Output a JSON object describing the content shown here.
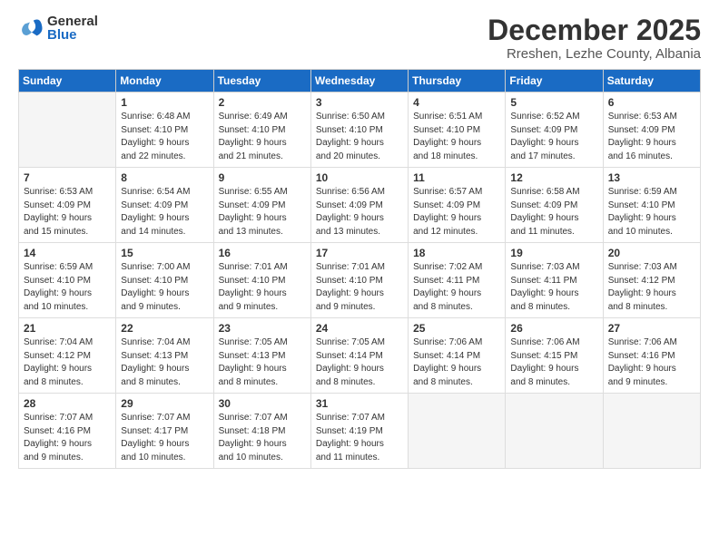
{
  "logo": {
    "general": "General",
    "blue": "Blue"
  },
  "header": {
    "month": "December 2025",
    "location": "Rreshen, Lezhe County, Albania"
  },
  "weekdays": [
    "Sunday",
    "Monday",
    "Tuesday",
    "Wednesday",
    "Thursday",
    "Friday",
    "Saturday"
  ],
  "weeks": [
    [
      {
        "day": "",
        "info": ""
      },
      {
        "day": "1",
        "info": "Sunrise: 6:48 AM\nSunset: 4:10 PM\nDaylight: 9 hours\nand 22 minutes."
      },
      {
        "day": "2",
        "info": "Sunrise: 6:49 AM\nSunset: 4:10 PM\nDaylight: 9 hours\nand 21 minutes."
      },
      {
        "day": "3",
        "info": "Sunrise: 6:50 AM\nSunset: 4:10 PM\nDaylight: 9 hours\nand 20 minutes."
      },
      {
        "day": "4",
        "info": "Sunrise: 6:51 AM\nSunset: 4:10 PM\nDaylight: 9 hours\nand 18 minutes."
      },
      {
        "day": "5",
        "info": "Sunrise: 6:52 AM\nSunset: 4:09 PM\nDaylight: 9 hours\nand 17 minutes."
      },
      {
        "day": "6",
        "info": "Sunrise: 6:53 AM\nSunset: 4:09 PM\nDaylight: 9 hours\nand 16 minutes."
      }
    ],
    [
      {
        "day": "7",
        "info": "Sunrise: 6:53 AM\nSunset: 4:09 PM\nDaylight: 9 hours\nand 15 minutes."
      },
      {
        "day": "8",
        "info": "Sunrise: 6:54 AM\nSunset: 4:09 PM\nDaylight: 9 hours\nand 14 minutes."
      },
      {
        "day": "9",
        "info": "Sunrise: 6:55 AM\nSunset: 4:09 PM\nDaylight: 9 hours\nand 13 minutes."
      },
      {
        "day": "10",
        "info": "Sunrise: 6:56 AM\nSunset: 4:09 PM\nDaylight: 9 hours\nand 13 minutes."
      },
      {
        "day": "11",
        "info": "Sunrise: 6:57 AM\nSunset: 4:09 PM\nDaylight: 9 hours\nand 12 minutes."
      },
      {
        "day": "12",
        "info": "Sunrise: 6:58 AM\nSunset: 4:09 PM\nDaylight: 9 hours\nand 11 minutes."
      },
      {
        "day": "13",
        "info": "Sunrise: 6:59 AM\nSunset: 4:10 PM\nDaylight: 9 hours\nand 10 minutes."
      }
    ],
    [
      {
        "day": "14",
        "info": "Sunrise: 6:59 AM\nSunset: 4:10 PM\nDaylight: 9 hours\nand 10 minutes."
      },
      {
        "day": "15",
        "info": "Sunrise: 7:00 AM\nSunset: 4:10 PM\nDaylight: 9 hours\nand 9 minutes."
      },
      {
        "day": "16",
        "info": "Sunrise: 7:01 AM\nSunset: 4:10 PM\nDaylight: 9 hours\nand 9 minutes."
      },
      {
        "day": "17",
        "info": "Sunrise: 7:01 AM\nSunset: 4:10 PM\nDaylight: 9 hours\nand 9 minutes."
      },
      {
        "day": "18",
        "info": "Sunrise: 7:02 AM\nSunset: 4:11 PM\nDaylight: 9 hours\nand 8 minutes."
      },
      {
        "day": "19",
        "info": "Sunrise: 7:03 AM\nSunset: 4:11 PM\nDaylight: 9 hours\nand 8 minutes."
      },
      {
        "day": "20",
        "info": "Sunrise: 7:03 AM\nSunset: 4:12 PM\nDaylight: 9 hours\nand 8 minutes."
      }
    ],
    [
      {
        "day": "21",
        "info": "Sunrise: 7:04 AM\nSunset: 4:12 PM\nDaylight: 9 hours\nand 8 minutes."
      },
      {
        "day": "22",
        "info": "Sunrise: 7:04 AM\nSunset: 4:13 PM\nDaylight: 9 hours\nand 8 minutes."
      },
      {
        "day": "23",
        "info": "Sunrise: 7:05 AM\nSunset: 4:13 PM\nDaylight: 9 hours\nand 8 minutes."
      },
      {
        "day": "24",
        "info": "Sunrise: 7:05 AM\nSunset: 4:14 PM\nDaylight: 9 hours\nand 8 minutes."
      },
      {
        "day": "25",
        "info": "Sunrise: 7:06 AM\nSunset: 4:14 PM\nDaylight: 9 hours\nand 8 minutes."
      },
      {
        "day": "26",
        "info": "Sunrise: 7:06 AM\nSunset: 4:15 PM\nDaylight: 9 hours\nand 8 minutes."
      },
      {
        "day": "27",
        "info": "Sunrise: 7:06 AM\nSunset: 4:16 PM\nDaylight: 9 hours\nand 9 minutes."
      }
    ],
    [
      {
        "day": "28",
        "info": "Sunrise: 7:07 AM\nSunset: 4:16 PM\nDaylight: 9 hours\nand 9 minutes."
      },
      {
        "day": "29",
        "info": "Sunrise: 7:07 AM\nSunset: 4:17 PM\nDaylight: 9 hours\nand 10 minutes."
      },
      {
        "day": "30",
        "info": "Sunrise: 7:07 AM\nSunset: 4:18 PM\nDaylight: 9 hours\nand 10 minutes."
      },
      {
        "day": "31",
        "info": "Sunrise: 7:07 AM\nSunset: 4:19 PM\nDaylight: 9 hours\nand 11 minutes."
      },
      {
        "day": "",
        "info": ""
      },
      {
        "day": "",
        "info": ""
      },
      {
        "day": "",
        "info": ""
      }
    ]
  ]
}
